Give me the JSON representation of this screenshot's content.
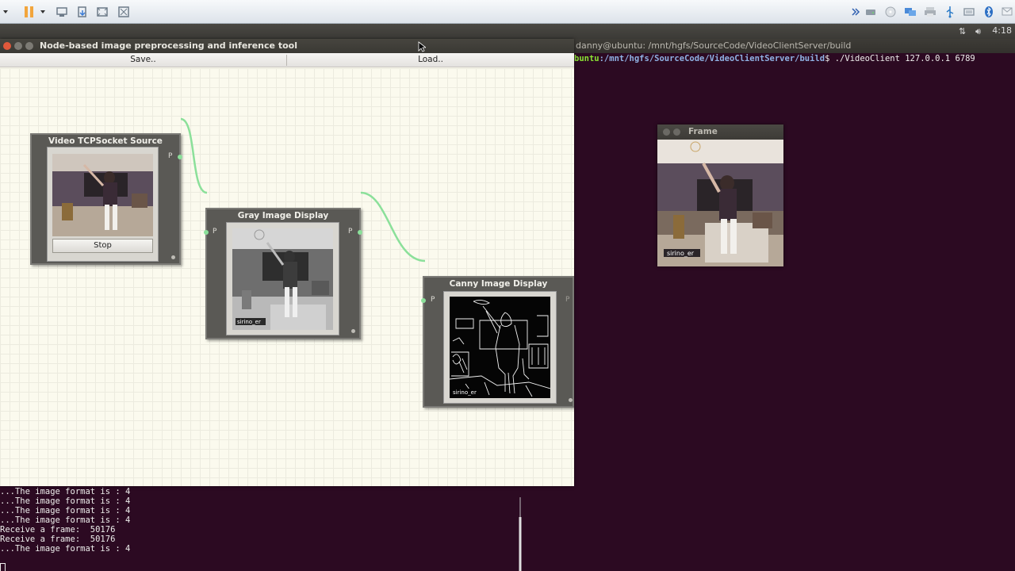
{
  "node_window": {
    "title": "Node-based image preprocessing and inference tool",
    "menu": {
      "save": "Save..",
      "load": "Load.."
    }
  },
  "nodes": {
    "video_source": {
      "title": "Video TCPSocket Source",
      "port_out": "P",
      "button": "Stop"
    },
    "gray_display": {
      "title": "Gray Image Display",
      "port_in": "P",
      "port_out": "P",
      "caption": "sirino_er"
    },
    "canny_display": {
      "title": "Canny Image Display",
      "port_in": "P",
      "port_out": "P",
      "caption": "sirino_er"
    }
  },
  "terminal": {
    "title": "danny@ubuntu: /mnt/hgfs/SourceCode/VideoClientServer/build",
    "prompt_user": "buntu",
    "prompt_path": ":/mnt/hgfs/SourceCode/VideoClientServer/build",
    "command": "$ ./VideoClient 127.0.0.1 6789"
  },
  "console_lines": [
    "...The image format is : 4",
    "...The image format is : 4",
    "...The image format is : 4",
    "...The image format is : 4",
    "Receive a frame:  50176",
    "Receive a frame:  50176",
    "...The image format is : 4"
  ],
  "frame_window": {
    "title": "Frame",
    "caption": "sirino_er"
  },
  "top_panel": {
    "clock": "4:18"
  },
  "colors": {
    "link": "#8be09a",
    "node_bg": "#5a5955",
    "canvas_bg": "#fbfaee",
    "terminal_bg": "#2c0a22"
  }
}
